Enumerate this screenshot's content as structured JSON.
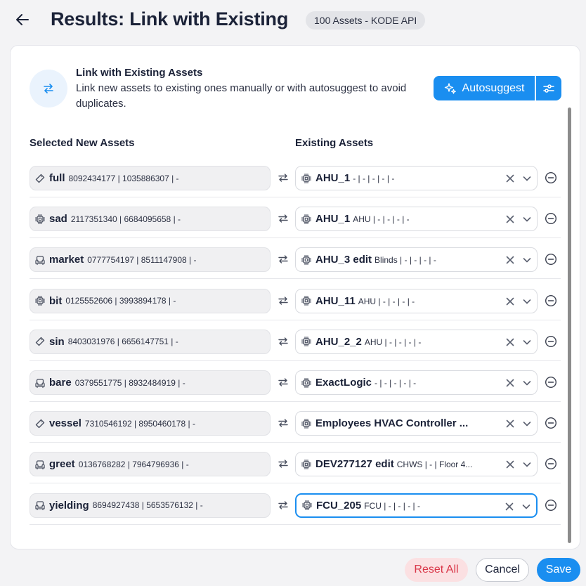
{
  "header": {
    "title": "Results: Link with Existing",
    "badge": "100 Assets - KODE API"
  },
  "intro": {
    "title": "Link with Existing Assets",
    "description": "Link new assets to existing ones manually or with autosuggest to avoid duplicates."
  },
  "actions": {
    "autosuggest_label": "Autosuggest"
  },
  "columns": {
    "new": "Selected New Assets",
    "existing": "Existing Assets"
  },
  "rows": [
    {
      "icon": "tag-icon",
      "name": "full",
      "meta": "8092434177 | 1035886307 | -",
      "existing_name": "AHU_1",
      "existing_meta": "- | - | - | - | -"
    },
    {
      "icon": "chip-icon",
      "name": "sad",
      "meta": "2117351340 | 6684095658 | -",
      "existing_name": "AHU_1",
      "existing_meta": "AHU | - | - | - | -"
    },
    {
      "icon": "couch-icon",
      "name": "market",
      "meta": "0777754197 | 8511147908 | -",
      "existing_name": "AHU_3 edit",
      "existing_meta": "Blinds | - | - | - | -"
    },
    {
      "icon": "chip-icon",
      "name": "bit",
      "meta": "0125552606 | 3993894178 | -",
      "existing_name": "AHU_11",
      "existing_meta": "AHU | - | - | - | -"
    },
    {
      "icon": "tag-icon",
      "name": "sin",
      "meta": "8403031976 | 6656147751 | -",
      "existing_name": "AHU_2_2",
      "existing_meta": "AHU | - | - | - | -"
    },
    {
      "icon": "couch-icon",
      "name": "bare",
      "meta": "0379551775 | 8932484919 | -",
      "existing_name": "ExactLogic",
      "existing_meta": "- | - | - | - | -"
    },
    {
      "icon": "tag-icon",
      "name": "vessel",
      "meta": "7310546192 | 8950460178 | -",
      "existing_name": "Employees HVAC Controller ...",
      "existing_meta": ""
    },
    {
      "icon": "couch-icon",
      "name": "greet",
      "meta": "0136768282 | 7964796936 | -",
      "existing_name": "DEV277127 edit",
      "existing_meta": "CHWS | - | Floor 4..."
    },
    {
      "icon": "couch-icon",
      "name": "yielding",
      "meta": "8694927438 | 5653576132 | -",
      "existing_name": "FCU_205",
      "existing_meta": "FCU | - | - | - | -"
    }
  ],
  "footer": {
    "reset_label": "Reset All",
    "cancel_label": "Cancel",
    "save_label": "Save"
  },
  "colors": {
    "accent": "#1a8ef0",
    "danger": "#d93648",
    "danger_bg": "#fbe0e2",
    "text": "#1b2238"
  }
}
